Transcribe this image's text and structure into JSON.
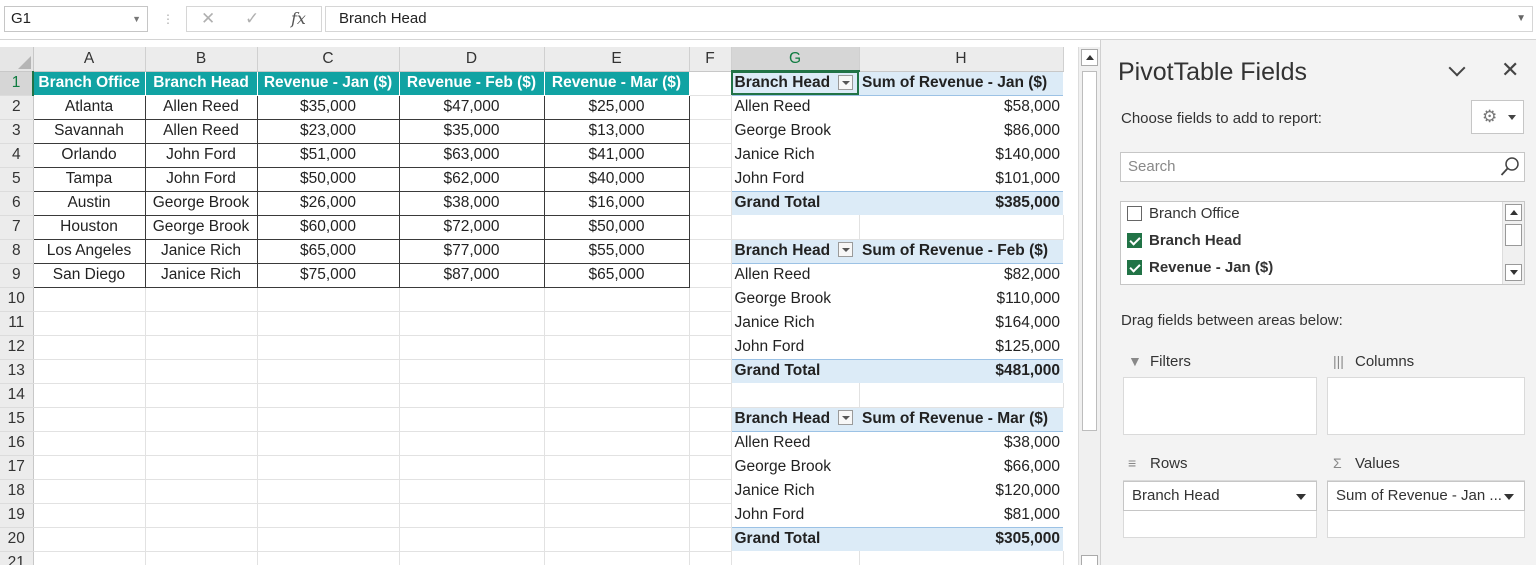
{
  "formula_bar": {
    "name_box": "G1",
    "cancel_glyph": "✕",
    "enter_glyph": "✓",
    "fx_glyph": "fx",
    "content": "Branch Head"
  },
  "sheet": {
    "columns": [
      "A",
      "B",
      "C",
      "D",
      "E",
      "F",
      "G",
      "H"
    ],
    "rows": [
      "1",
      "2",
      "3",
      "4",
      "5",
      "6",
      "7",
      "8",
      "9",
      "10",
      "11",
      "12",
      "13",
      "14",
      "15",
      "16",
      "17",
      "18",
      "19",
      "20",
      "21"
    ],
    "source": {
      "headers": [
        "Branch Office",
        "Branch Head",
        "Revenue - Jan ($)",
        "Revenue - Feb ($)",
        "Revenue - Mar ($)"
      ],
      "rows": [
        [
          "Atlanta",
          "Allen Reed",
          "$35,000",
          "$47,000",
          "$25,000"
        ],
        [
          "Savannah",
          "Allen Reed",
          "$23,000",
          "$35,000",
          "$13,000"
        ],
        [
          "Orlando",
          "John Ford",
          "$51,000",
          "$63,000",
          "$41,000"
        ],
        [
          "Tampa",
          "John Ford",
          "$50,000",
          "$62,000",
          "$40,000"
        ],
        [
          "Austin",
          "George Brook",
          "$26,000",
          "$38,000",
          "$16,000"
        ],
        [
          "Houston",
          "George Brook",
          "$60,000",
          "$72,000",
          "$50,000"
        ],
        [
          "Los Angeles",
          "Janice Rich",
          "$65,000",
          "$77,000",
          "$55,000"
        ],
        [
          "San Diego",
          "Janice Rich",
          "$75,000",
          "$87,000",
          "$65,000"
        ]
      ]
    },
    "pivots": [
      {
        "row_header": "Branch Head",
        "value_header": "Sum of Revenue - Jan ($)",
        "rows": [
          [
            "Allen Reed",
            "$58,000"
          ],
          [
            "George Brook",
            "$86,000"
          ],
          [
            "Janice Rich",
            "$140,000"
          ],
          [
            "John Ford",
            "$101,000"
          ]
        ],
        "total_label": "Grand Total",
        "total_value": "$385,000"
      },
      {
        "row_header": "Branch Head",
        "value_header": "Sum of Revenue - Feb ($)",
        "rows": [
          [
            "Allen Reed",
            "$82,000"
          ],
          [
            "George Brook",
            "$110,000"
          ],
          [
            "Janice Rich",
            "$164,000"
          ],
          [
            "John Ford",
            "$125,000"
          ]
        ],
        "total_label": "Grand Total",
        "total_value": "$481,000"
      },
      {
        "row_header": "Branch Head",
        "value_header": "Sum of Revenue - Mar ($)",
        "rows": [
          [
            "Allen Reed",
            "$38,000"
          ],
          [
            "George Brook",
            "$66,000"
          ],
          [
            "Janice Rich",
            "$120,000"
          ],
          [
            "John Ford",
            "$81,000"
          ]
        ],
        "total_label": "Grand Total",
        "total_value": "$305,000"
      }
    ]
  },
  "pane": {
    "title": "PivotTable Fields",
    "close_glyph": "✕",
    "choose_label": "Choose fields to add to report:",
    "gear_glyph": "⚙",
    "search_placeholder": "Search",
    "fields": [
      {
        "label": "Branch Office",
        "checked": false
      },
      {
        "label": "Branch Head",
        "checked": true
      },
      {
        "label": "Revenue - Jan ($)",
        "checked": true
      }
    ],
    "drag_label": "Drag fields between areas below:",
    "areas": {
      "filters": "Filters",
      "columns": "Columns",
      "rows": "Rows",
      "values": "Values",
      "values_icon": "Σ",
      "rows_value": "Branch Head",
      "values_value": "Sum of Revenue - Jan ..."
    }
  }
}
